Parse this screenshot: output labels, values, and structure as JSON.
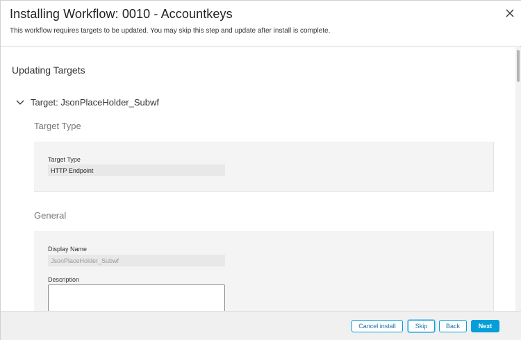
{
  "header": {
    "title": "Installing Workflow: 0010 - Accountkeys",
    "subtitle": "This workflow requires targets to be updated. You may skip this step and update after install is complete.",
    "close_icon": "close-icon"
  },
  "body": {
    "section_title": "Updating Targets",
    "target": {
      "title": "Target: JsonPlaceHolder_Subwf",
      "expanded": true,
      "toggle_icon": "chevron-down-icon"
    },
    "target_type_section": {
      "heading": "Target Type",
      "field_label": "Target Type",
      "field_value": "HTTP Endpoint"
    },
    "general_section": {
      "heading": "General",
      "display_name_label": "Display Name",
      "display_name_value": "JsonPlaceHolder_Subwf",
      "description_label": "Description",
      "description_value": ""
    }
  },
  "footer": {
    "cancel_label": "Cancel install",
    "skip_label": "Skip",
    "back_label": "Back",
    "next_label": "Next"
  },
  "colors": {
    "accent": "#049fd9",
    "card_background": "#f4f4f4",
    "footer_background": "#f0f0f0"
  }
}
